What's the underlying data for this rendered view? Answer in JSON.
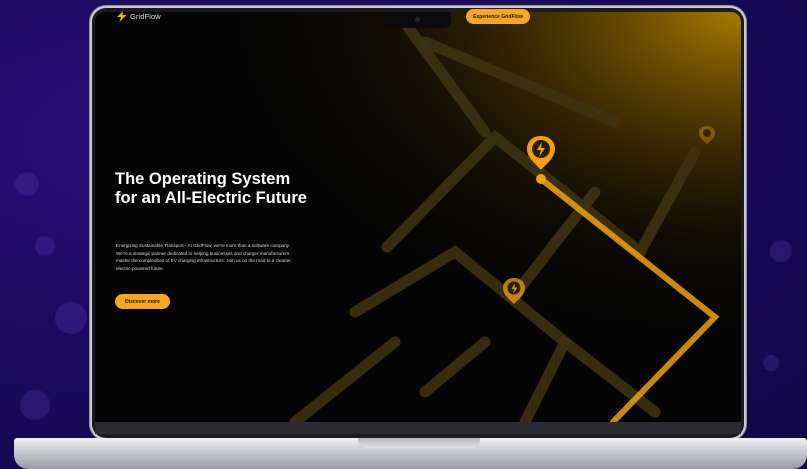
{
  "brand": {
    "name": "GridFlow",
    "icon": "lightning-bolt-icon"
  },
  "header": {
    "cta_label": "Experience GridFlow"
  },
  "hero": {
    "title": "The Operating System for an All-Electric Future",
    "description": "Energizing Sustainable Transport - At GridFlow, we're more than a software company. We're a strategic partner dedicated to helping businesses and charger manufacturers master the complexities of EV charging infrastructure. Join us on the road to a cleaner, electric-powered future.",
    "cta_label": "Discover more"
  },
  "map": {
    "pins": [
      "charging-pin-icon",
      "charging-pin-icon",
      "charging-pin-icon"
    ]
  },
  "colors": {
    "accent": "#f5a623",
    "background_outer": "#1a0a5e",
    "screen_bg": "#050505",
    "road": "#3d3210",
    "route": "#f0a010"
  }
}
